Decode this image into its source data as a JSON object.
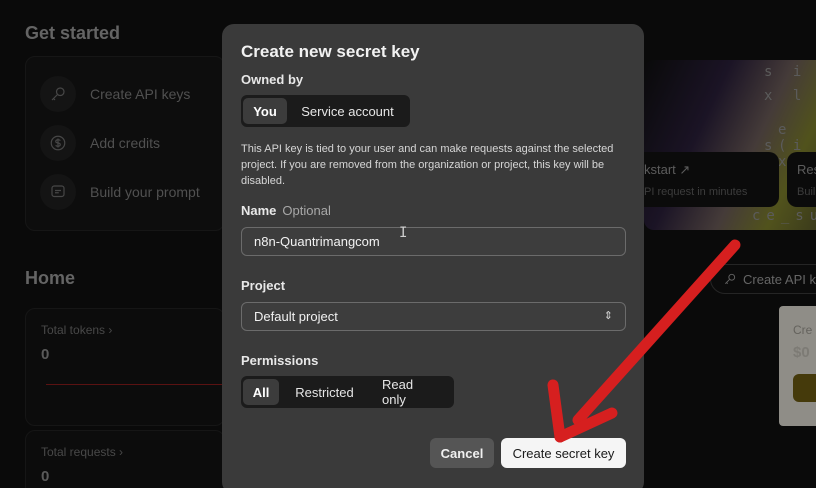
{
  "background": {
    "get_started": {
      "title": "Get started",
      "items": [
        {
          "label": "Create API keys",
          "icon": "key-icon"
        },
        {
          "label": "Add credits",
          "icon": "dollar-icon"
        },
        {
          "label": "Build your prompt",
          "icon": "chat-icon"
        }
      ]
    },
    "home": {
      "title": "Home",
      "stats": [
        {
          "label": "Total tokens ›",
          "value": "0"
        },
        {
          "label": "Total requests ›",
          "value": "0"
        }
      ]
    },
    "quickstart": {
      "title": "kstart ↗",
      "sub": "PI request in minutes",
      "title2": "Res",
      "sub2": "Buil"
    },
    "api_button_label": "Create API ke",
    "credit": {
      "text": "Cre",
      "value": "$0"
    },
    "art_text": [
      "s  i",
      "x  l",
      "e ( x",
      "s  i",
      "ce_su"
    ]
  },
  "modal": {
    "title": "Create new secret key",
    "owned_by": {
      "label": "Owned by",
      "options": [
        "You",
        "Service account"
      ],
      "selected": "You"
    },
    "description": "This API key is tied to your user and can make requests against the selected project. If you are removed from the organization or project, this key will be disabled.",
    "name": {
      "label": "Name",
      "optional": "Optional",
      "value": "n8n-Quantrimangcom"
    },
    "project": {
      "label": "Project",
      "value": "Default project"
    },
    "permissions": {
      "label": "Permissions",
      "options": [
        "All",
        "Restricted",
        "Read only"
      ],
      "selected": "All"
    },
    "cancel_label": "Cancel",
    "create_label": "Create secret key"
  },
  "colors": {
    "modal_bg": "#3a3a3a",
    "arrow": "#d61f1f",
    "primary_button": "#f5f5f5"
  }
}
